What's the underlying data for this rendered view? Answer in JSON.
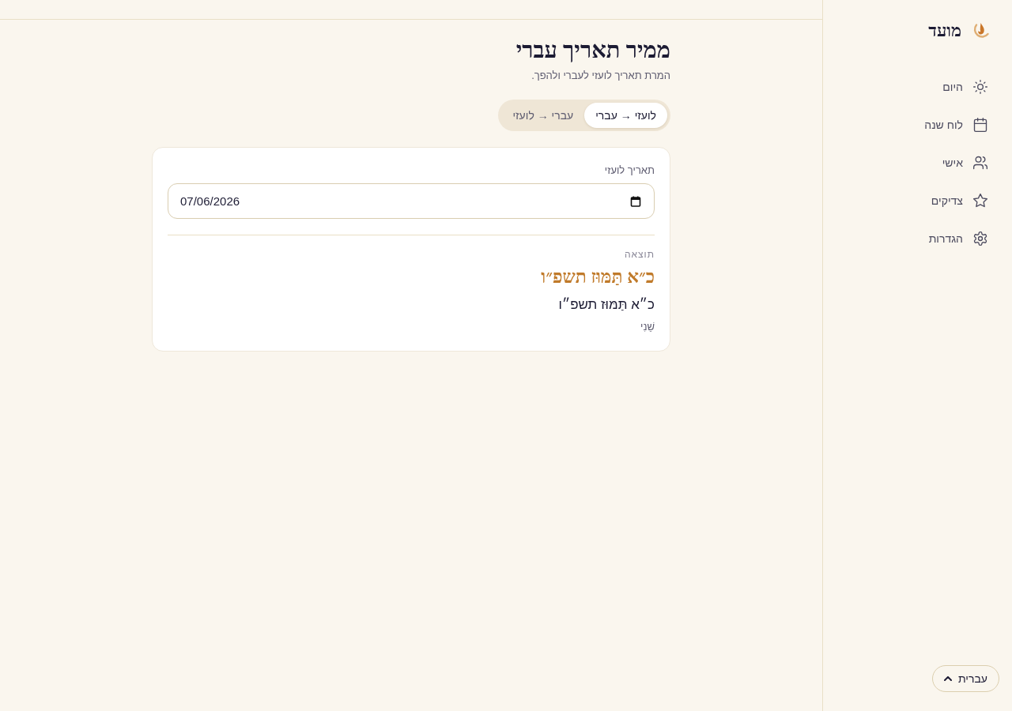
{
  "sidebar": {
    "logo": "מועד",
    "items": [
      {
        "label": "היום",
        "selected": false
      },
      {
        "label": "לוח שנה",
        "selected": false
      },
      {
        "label": "אישי",
        "selected": false
      },
      {
        "label": "צדיקים",
        "selected": false
      },
      {
        "label": "הגדרות",
        "selected": false
      }
    ],
    "language_button": "עברית"
  },
  "page": {
    "title": "ממיר תאריך עברי",
    "subtitle": "המרת תאריך לועזי לעברי ולהפך."
  },
  "mode_tabs": [
    {
      "label": "לועזי → עברי",
      "selected": true
    },
    {
      "label": "עברי → לועזי",
      "selected": false
    }
  ],
  "converter_card": {
    "field_label": "תאריך לועזי",
    "date_value": "07/06/2026",
    "result_label": "תוצאה",
    "hebrew_date": "כ״א תַּמּוּז תשפ״ו",
    "hebrew_date_plain": "כ״א תַּמּוּז תשפ״ו",
    "weekday": "שֵׁנִי"
  }
}
